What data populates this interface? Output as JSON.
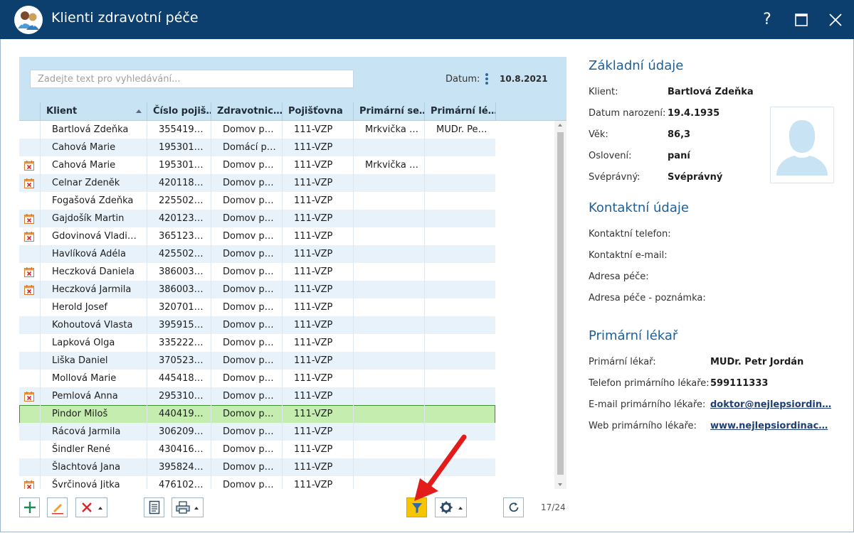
{
  "window": {
    "title": "Klienti zdravotní péče",
    "help_glyph": "?",
    "maximize_glyph": "☐",
    "close_glyph": "✕"
  },
  "search": {
    "placeholder": "Zadejte text pro vyhledávání...",
    "value": ""
  },
  "date": {
    "label": "Datum:",
    "value": "10.8.2021"
  },
  "grid": {
    "columns": [
      "Klient",
      "Číslo pojiš…",
      "Zdravotnic…",
      "Pojišťovna",
      "Primární se…",
      "Primární lé…"
    ],
    "sort_column": "Klient",
    "rows": [
      {
        "icon": false,
        "name": "Bartlová Zdeňka",
        "ins_no": "355419…",
        "facility": "Domov p…",
        "insurer": "111-VZP",
        "nurse": "Mrkvička …",
        "doctor": "MUDr. Pe…"
      },
      {
        "icon": false,
        "name": "Cahová Marie",
        "ins_no": "195301…",
        "facility": "Domácí p…",
        "insurer": "111-VZP",
        "nurse": "",
        "doctor": ""
      },
      {
        "icon": true,
        "name": "Cahová Marie",
        "ins_no": "195301…",
        "facility": "Domov p…",
        "insurer": "111-VZP",
        "nurse": "Mrkvička …",
        "doctor": ""
      },
      {
        "icon": true,
        "name": "Celnar Zdeněk",
        "ins_no": "420118…",
        "facility": "Domov p…",
        "insurer": "111-VZP",
        "nurse": "",
        "doctor": ""
      },
      {
        "icon": false,
        "name": "Fogašová Zdeňka",
        "ins_no": "225502…",
        "facility": "Domov p…",
        "insurer": "111-VZP",
        "nurse": "",
        "doctor": ""
      },
      {
        "icon": true,
        "name": "Gajdošík Martin",
        "ins_no": "420123…",
        "facility": "Domov p…",
        "insurer": "111-VZP",
        "nurse": "",
        "doctor": ""
      },
      {
        "icon": true,
        "name": "Gdovinová Vladi…",
        "ins_no": "365123…",
        "facility": "Domov p…",
        "insurer": "111-VZP",
        "nurse": "",
        "doctor": ""
      },
      {
        "icon": false,
        "name": "Havlíková Adéla",
        "ins_no": "425502…",
        "facility": "Domov p…",
        "insurer": "111-VZP",
        "nurse": "",
        "doctor": ""
      },
      {
        "icon": true,
        "name": "Heczková Daniela",
        "ins_no": "386003…",
        "facility": "Domov p…",
        "insurer": "111-VZP",
        "nurse": "",
        "doctor": ""
      },
      {
        "icon": true,
        "name": "Heczková Jarmila",
        "ins_no": "386003…",
        "facility": "Domov p…",
        "insurer": "111-VZP",
        "nurse": "",
        "doctor": ""
      },
      {
        "icon": false,
        "name": "Herold Josef",
        "ins_no": "320701…",
        "facility": "Domov p…",
        "insurer": "111-VZP",
        "nurse": "",
        "doctor": ""
      },
      {
        "icon": false,
        "name": "Kohoutová Vlasta",
        "ins_no": "395915…",
        "facility": "Domov p…",
        "insurer": "111-VZP",
        "nurse": "",
        "doctor": ""
      },
      {
        "icon": false,
        "name": "Lapková Olga",
        "ins_no": "335222…",
        "facility": "Domov p…",
        "insurer": "111-VZP",
        "nurse": "",
        "doctor": ""
      },
      {
        "icon": false,
        "name": "Liška Daniel",
        "ins_no": "370523…",
        "facility": "Domov p…",
        "insurer": "111-VZP",
        "nurse": "",
        "doctor": ""
      },
      {
        "icon": false,
        "name": "Mollová Marie",
        "ins_no": "445418…",
        "facility": "Domov p…",
        "insurer": "111-VZP",
        "nurse": "",
        "doctor": ""
      },
      {
        "icon": true,
        "name": "Pemlová Anna",
        "ins_no": "295310…",
        "facility": "Domov p…",
        "insurer": "111-VZP",
        "nurse": "",
        "doctor": ""
      },
      {
        "icon": false,
        "name": "Pindor Miloš",
        "ins_no": "440419…",
        "facility": "Domov p…",
        "insurer": "111-VZP",
        "nurse": "",
        "doctor": "",
        "selected": true
      },
      {
        "icon": false,
        "name": "Rácová Jarmila",
        "ins_no": "306209…",
        "facility": "Domov p…",
        "insurer": "111-VZP",
        "nurse": "",
        "doctor": ""
      },
      {
        "icon": false,
        "name": "Šindler René",
        "ins_no": "430416…",
        "facility": "Domov p…",
        "insurer": "111-VZP",
        "nurse": "",
        "doctor": ""
      },
      {
        "icon": false,
        "name": "Šlachtová Jana",
        "ins_no": "395824…",
        "facility": "Domov p…",
        "insurer": "111-VZP",
        "nurse": "",
        "doctor": ""
      },
      {
        "icon": true,
        "name": "Švrčinová Jitka",
        "ins_no": "476102…",
        "facility": "Domov p…",
        "insurer": "111-VZP",
        "nurse": "",
        "doctor": ""
      }
    ]
  },
  "toolbar": {
    "counter": "17/24",
    "icons": [
      "add-icon",
      "edit-icon",
      "delete-icon",
      "document-icon",
      "print-icon",
      "filter-icon",
      "settings-icon",
      "refresh-icon"
    ]
  },
  "details": {
    "basic": {
      "title": "Základní údaje",
      "client_label": "Klient:",
      "client_value": "Bartlová Zdeňka",
      "birth_label": "Datum narození:",
      "birth_value": "19.4.1935",
      "age_label": "Věk:",
      "age_value": "86,3",
      "salutation_label": "Oslovení:",
      "salutation_value": "paní",
      "capacity_label": "Svéprávný:",
      "capacity_value": "Svéprávný"
    },
    "contact": {
      "title": "Kontaktní údaje",
      "phone_label": "Kontaktní telefon:",
      "email_label": "Kontaktní e-mail:",
      "address_label": "Adresa péče:",
      "address_note_label": "Adresa péče - poznámka:"
    },
    "doctor": {
      "title": "Primární lékař",
      "doctor_label": "Primární lékař:",
      "doctor_value": "MUDr. Petr Jordán",
      "phone_label": "Telefon primárního lékaře:",
      "phone_value": "599111333",
      "email_label": "E-mail primárního lékaře:",
      "email_value": "doktor@nejlepsiordin…",
      "web_label": "Web primárního lékaře:",
      "web_value": "www.nejlepsiordinac…"
    }
  },
  "colors": {
    "titlebar": "#0c3f6e",
    "accent": "#1f5f97",
    "header_bg": "#c8e3f4",
    "selected_row": "#c6edb0",
    "filter_button": "#f7c500",
    "annotation_arrow": "#e31b1b"
  }
}
